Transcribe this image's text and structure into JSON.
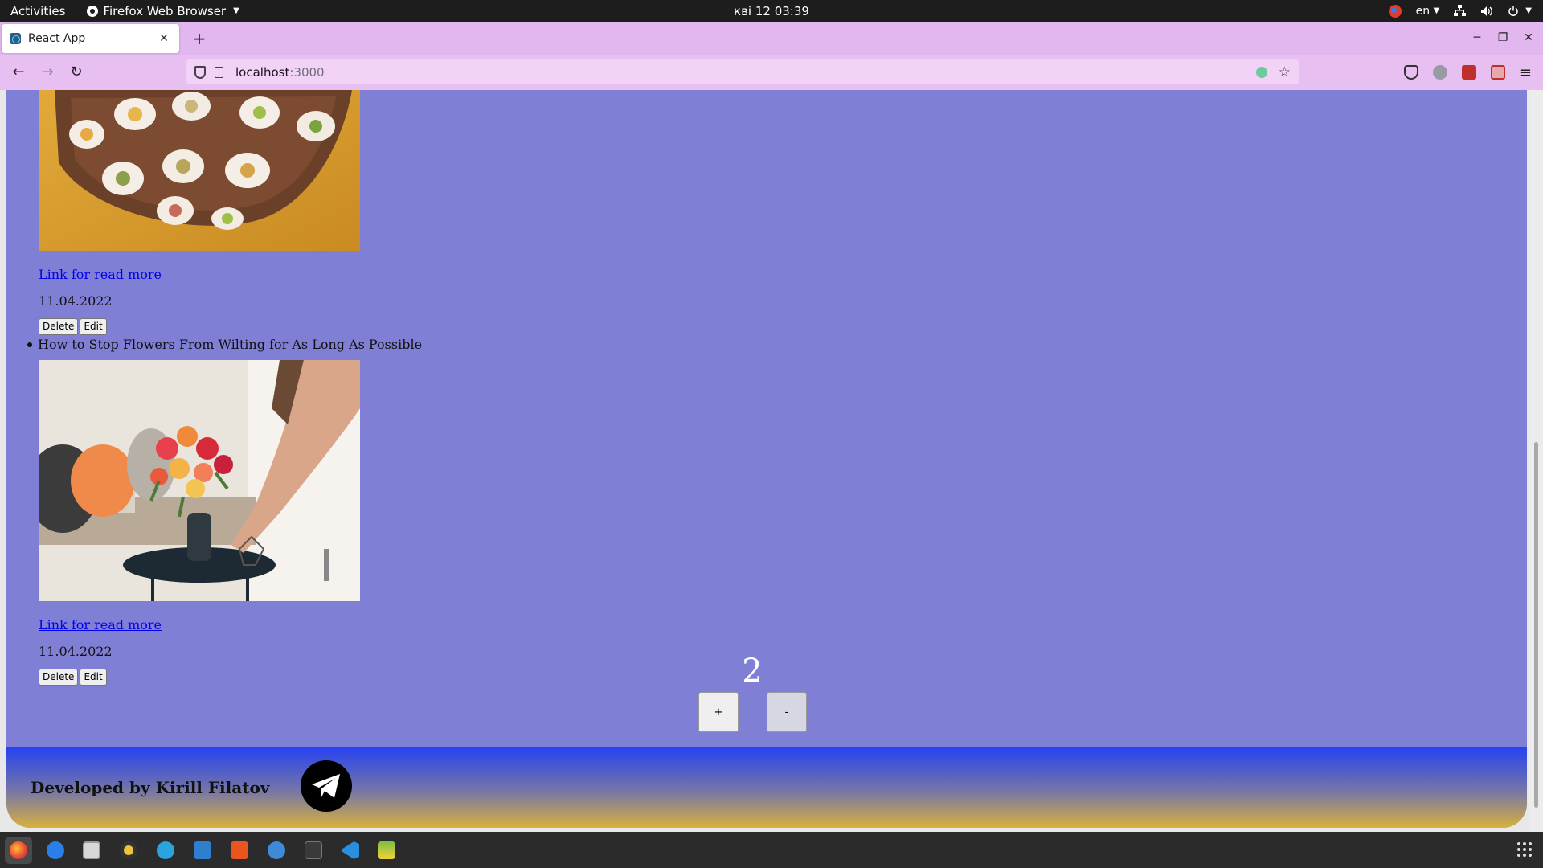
{
  "system": {
    "activities": "Activities",
    "app_name": "Firefox Web Browser",
    "clock": "кві 12  03:39",
    "language": "en"
  },
  "browser": {
    "tab_title": "React App",
    "url_host": "localhost",
    "url_port": ":3000"
  },
  "posts": [
    {
      "title": "",
      "link_text": "Link for read more",
      "date": "11.04.2022",
      "delete_label": "Delete",
      "edit_label": "Edit"
    },
    {
      "title": "How to Stop Flowers From Wilting for As Long As Possible",
      "link_text": "Link for read more",
      "date": "11.04.2022",
      "delete_label": "Delete",
      "edit_label": "Edit"
    }
  ],
  "counter": {
    "value": "2",
    "plus_label": "+",
    "minus_label": "-"
  },
  "footer": {
    "credit": "Developed by Kirill Filatov",
    "social_icon": "telegram-icon"
  },
  "colors": {
    "page_background": "#7f7fd5",
    "footer_top": "#2642f1",
    "footer_bottom": "#d8b13c",
    "tab_strip": "#e2b6ef"
  },
  "dock": [
    "firefox",
    "thunderbird",
    "files",
    "rhythmbox",
    "telegram",
    "writer",
    "software",
    "help",
    "terminal",
    "vscode",
    "image-viewer"
  ]
}
